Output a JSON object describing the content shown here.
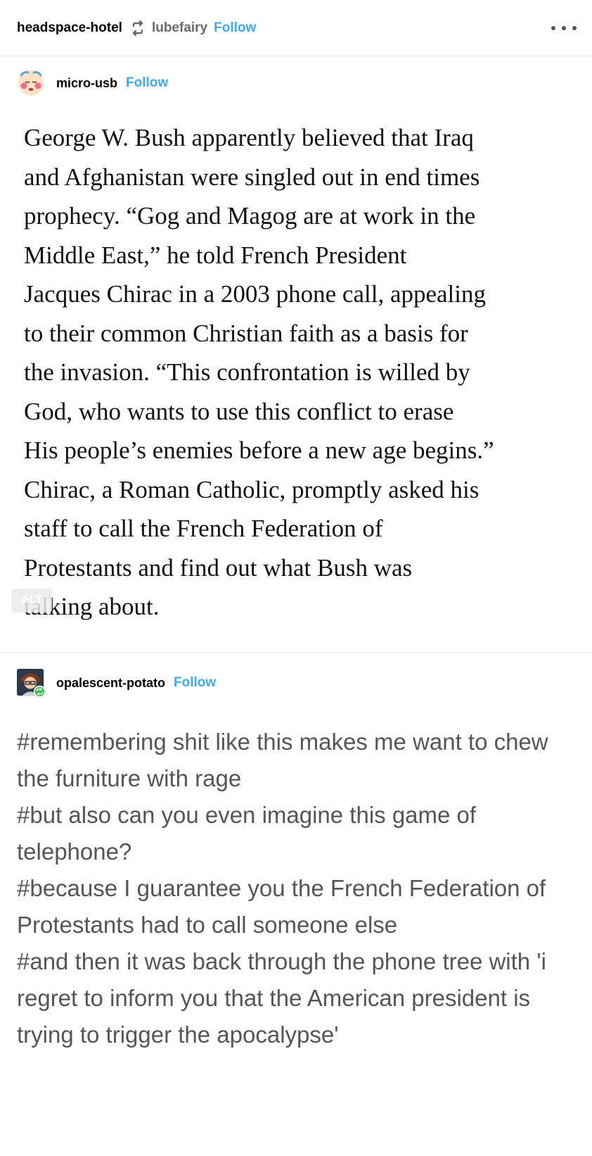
{
  "header": {
    "reblogger": "headspace-hotel",
    "via": "lubefairy",
    "follow_label": "Follow",
    "reblog_icon": "reblog-icon",
    "more_icon": "more-dots-icon"
  },
  "post1": {
    "author": "micro-usb",
    "follow_label": "Follow",
    "avatar_icon": "crying-face-avatar",
    "quote_lines": [
      "George W. Bush apparently believed that Iraq",
      "and Afghanistan were singled out in end times",
      "prophecy. “Gog and Magog are at work in the",
      "Middle East,” he told French President",
      "Jacques Chirac in a 2003 phone call, appealing",
      "to their common Christian faith as a basis for",
      "the invasion. “This confrontation is willed by",
      "God, who wants to use this conflict to erase",
      "His people’s enemies before a new age begins.”",
      "Chirac, a Roman Catholic, promptly asked his",
      "staff to call the French Federation of",
      "Protestants and find out what Bush was",
      "talking about."
    ],
    "alt_badge": "ALT"
  },
  "post2": {
    "author": "opalescent-potato",
    "follow_label": "Follow",
    "avatar_icon": "person-avatar",
    "reblog_badge_icon": "reblog-badge-icon",
    "tags": [
      "#remembering shit like this makes me want to chew the furniture with rage",
      "#but also can you even imagine this game of telephone?",
      "#because I guarantee you the French Federation of Protestants had to call someone else",
      "#and then it was back through the phone tree with 'i regret to inform you that the American president is trying to trigger the apocalypse'"
    ]
  },
  "colors": {
    "accent_follow": "#3fa9f5",
    "tag_text": "#555555",
    "divider": "#e6e6e6",
    "reblog_green": "#35c34f"
  }
}
